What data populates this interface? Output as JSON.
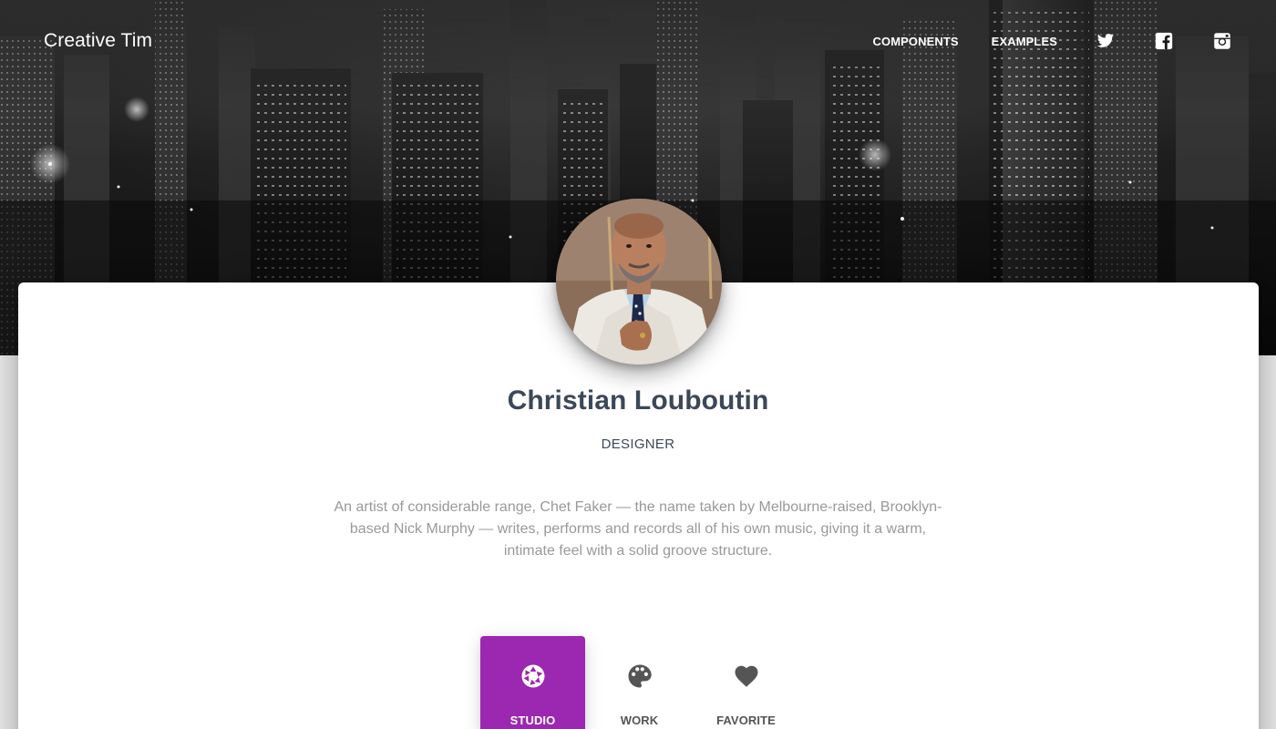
{
  "navbar": {
    "brand": "Creative Tim",
    "links": [
      {
        "label": "COMPONENTS"
      },
      {
        "label": "EXAMPLES"
      }
    ],
    "social": [
      {
        "icon": "twitter-icon"
      },
      {
        "icon": "facebook-icon"
      },
      {
        "icon": "instagram-icon"
      }
    ]
  },
  "profile": {
    "name": "Christian Louboutin",
    "role": "DESIGNER",
    "bio": "An artist of considerable range, Chet Faker — the name taken by Melbourne-raised, Brooklyn-based Nick Murphy — writes, performs and records all of his own music, giving it a warm, intimate feel with a solid groove structure."
  },
  "tabs": [
    {
      "label": "STUDIO",
      "icon": "camera-aperture-icon",
      "active": true
    },
    {
      "label": "WORK",
      "icon": "palette-icon",
      "active": false
    },
    {
      "label": "FAVORITE",
      "icon": "heart-icon",
      "active": false
    }
  ],
  "colors": {
    "accent": "#9c27b0",
    "heading": "#3c4858",
    "muted": "#999999",
    "page_bg": "#e5e5e5"
  }
}
